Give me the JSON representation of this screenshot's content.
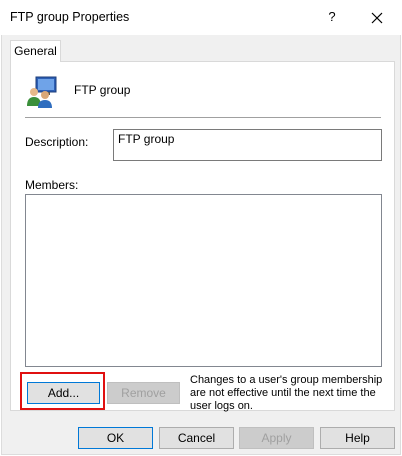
{
  "window": {
    "title": "FTP group Properties",
    "help_glyph": "?",
    "close_glyph": "✕"
  },
  "tabs": [
    {
      "label": "General",
      "selected": true
    }
  ],
  "general": {
    "group_icon": "users-group-icon",
    "group_name": "FTP group",
    "description_label": "Description:",
    "description_value": "FTP group",
    "members_label": "Members:",
    "members": [],
    "add_label": "Add...",
    "remove_label": "Remove",
    "note": "Changes to a user's group membership are not effective until the next time the user logs on."
  },
  "buttons": {
    "ok": "OK",
    "cancel": "Cancel",
    "apply": "Apply",
    "help": "Help"
  },
  "colors": {
    "highlight": "#e01010",
    "focus_border": "#0078d7"
  }
}
